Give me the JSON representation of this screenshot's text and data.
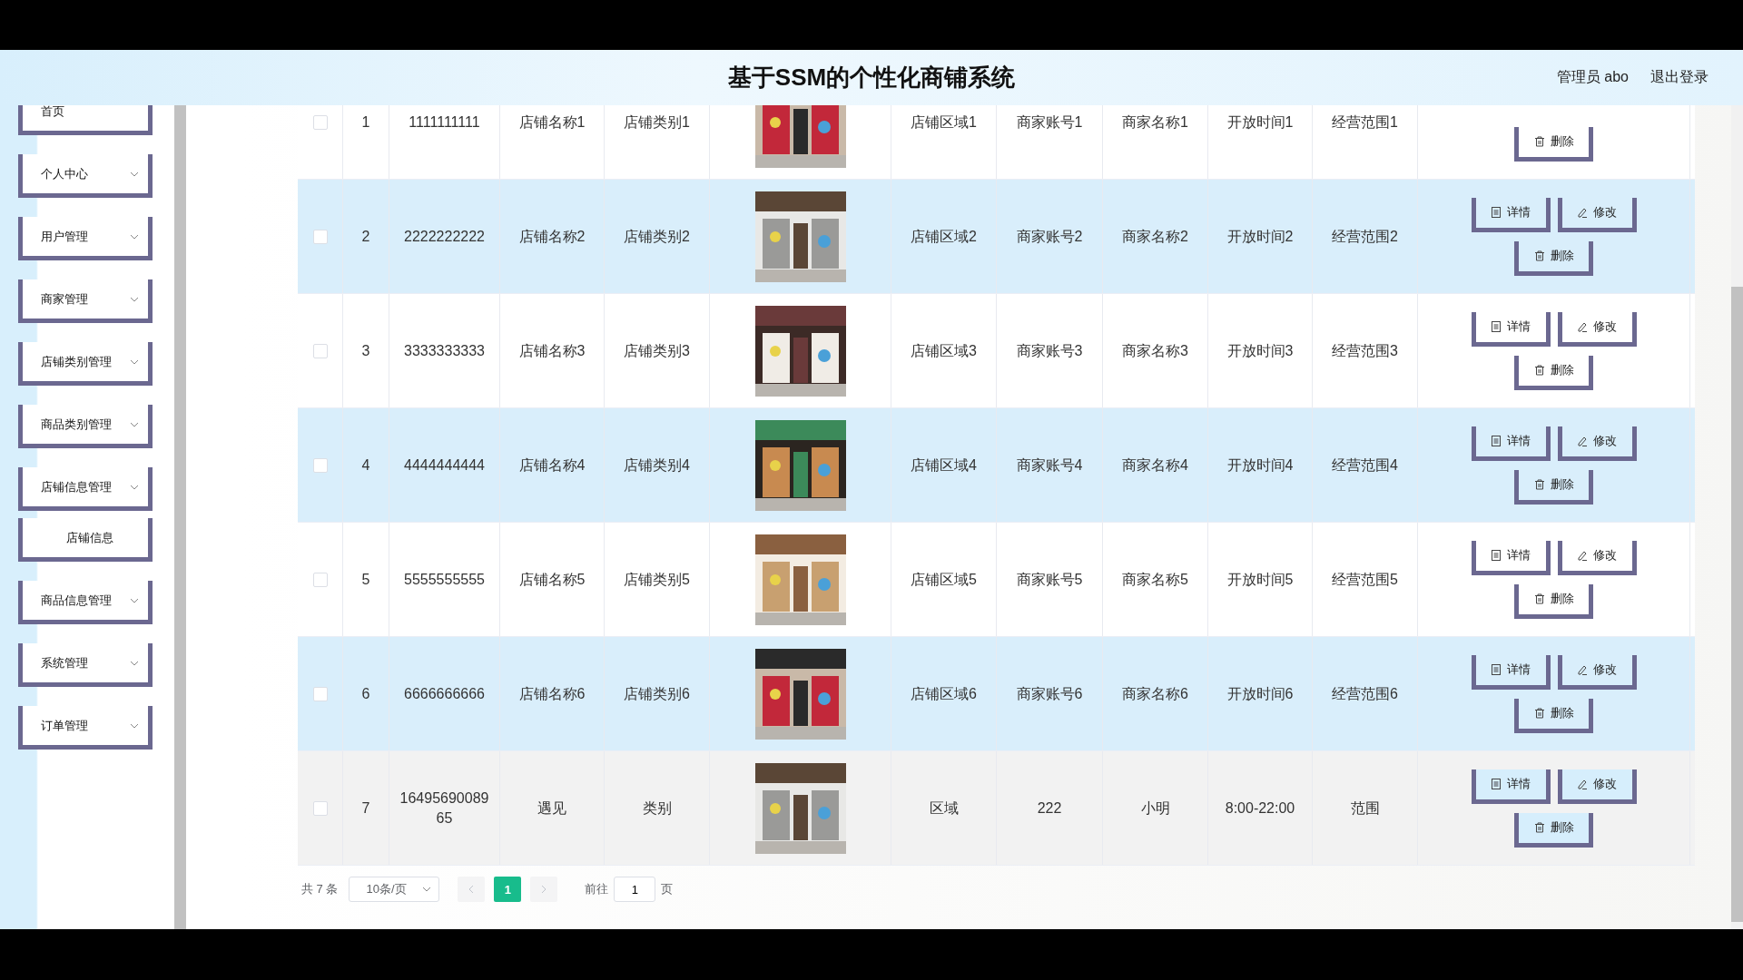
{
  "header": {
    "title": "基于SSM的个性化商铺系统",
    "user": "管理员 abo",
    "logout": "退出登录"
  },
  "sidebar": {
    "items": [
      {
        "label": "首页",
        "kind": "link"
      },
      {
        "label": "个人中心",
        "kind": "group"
      },
      {
        "label": "用户管理",
        "kind": "group"
      },
      {
        "label": "商家管理",
        "kind": "group"
      },
      {
        "label": "店铺类别管理",
        "kind": "group"
      },
      {
        "label": "商品类别管理",
        "kind": "group"
      },
      {
        "label": "店铺信息管理",
        "kind": "group",
        "children": [
          {
            "label": "店铺信息"
          }
        ]
      },
      {
        "label": "商品信息管理",
        "kind": "group"
      },
      {
        "label": "系统管理",
        "kind": "group"
      },
      {
        "label": "订单管理",
        "kind": "group"
      }
    ]
  },
  "table": {
    "rows": [
      {
        "index": "1",
        "id": "1111111111",
        "name": "店铺名称1",
        "type": "店铺类别1",
        "area": "店铺区域1",
        "account": "商家账号1",
        "merchant": "商家名称1",
        "hours": "开放时间1",
        "scope": "经营范围1",
        "checked": false,
        "hovered": false,
        "actions": [
          {
            "kind": "delete",
            "label": "删除"
          }
        ]
      },
      {
        "index": "2",
        "id": "2222222222",
        "name": "店铺名称2",
        "type": "店铺类别2",
        "area": "店铺区域2",
        "account": "商家账号2",
        "merchant": "商家名称2",
        "hours": "开放时间2",
        "scope": "经营范围2",
        "checked": false,
        "hovered": false,
        "actions": [
          {
            "kind": "detail",
            "label": "详情"
          },
          {
            "kind": "edit",
            "label": "修改"
          },
          {
            "kind": "delete",
            "label": "删除"
          }
        ]
      },
      {
        "index": "3",
        "id": "3333333333",
        "name": "店铺名称3",
        "type": "店铺类别3",
        "area": "店铺区域3",
        "account": "商家账号3",
        "merchant": "商家名称3",
        "hours": "开放时间3",
        "scope": "经营范围3",
        "checked": false,
        "hovered": false,
        "actions": [
          {
            "kind": "detail",
            "label": "详情"
          },
          {
            "kind": "edit",
            "label": "修改"
          },
          {
            "kind": "delete",
            "label": "删除"
          }
        ]
      },
      {
        "index": "4",
        "id": "4444444444",
        "name": "店铺名称4",
        "type": "店铺类别4",
        "area": "店铺区域4",
        "account": "商家账号4",
        "merchant": "商家名称4",
        "hours": "开放时间4",
        "scope": "经营范围4",
        "checked": false,
        "hovered": false,
        "actions": [
          {
            "kind": "detail",
            "label": "详情"
          },
          {
            "kind": "edit",
            "label": "修改"
          },
          {
            "kind": "delete",
            "label": "删除"
          }
        ]
      },
      {
        "index": "5",
        "id": "5555555555",
        "name": "店铺名称5",
        "type": "店铺类别5",
        "area": "店铺区域5",
        "account": "商家账号5",
        "merchant": "商家名称5",
        "hours": "开放时间5",
        "scope": "经营范围5",
        "checked": false,
        "hovered": false,
        "actions": [
          {
            "kind": "detail",
            "label": "详情"
          },
          {
            "kind": "edit",
            "label": "修改"
          },
          {
            "kind": "delete",
            "label": "删除"
          }
        ]
      },
      {
        "index": "6",
        "id": "6666666666",
        "name": "店铺名称6",
        "type": "店铺类别6",
        "area": "店铺区域6",
        "account": "商家账号6",
        "merchant": "商家名称6",
        "hours": "开放时间6",
        "scope": "经营范围6",
        "checked": false,
        "hovered": false,
        "actions": [
          {
            "kind": "detail",
            "label": "详情"
          },
          {
            "kind": "edit",
            "label": "修改"
          },
          {
            "kind": "delete",
            "label": "删除"
          }
        ]
      },
      {
        "index": "7",
        "id": "1649569008965",
        "name": "遇见",
        "type": "类别",
        "area": "区域",
        "account": "222",
        "merchant": "小明",
        "hours": "8:00-22:00",
        "scope": "范围",
        "checked": false,
        "hovered": true,
        "actions": [
          {
            "kind": "detail",
            "label": "详情"
          },
          {
            "kind": "edit",
            "label": "修改"
          },
          {
            "kind": "delete",
            "label": "删除"
          }
        ]
      }
    ]
  },
  "pagination": {
    "total": "共 7 条",
    "page_size": "10条/页",
    "pages": [
      {
        "label": "1",
        "selected": true
      }
    ],
    "goto_label": "前往",
    "goto_value": "1",
    "goto_suffix": "页"
  }
}
